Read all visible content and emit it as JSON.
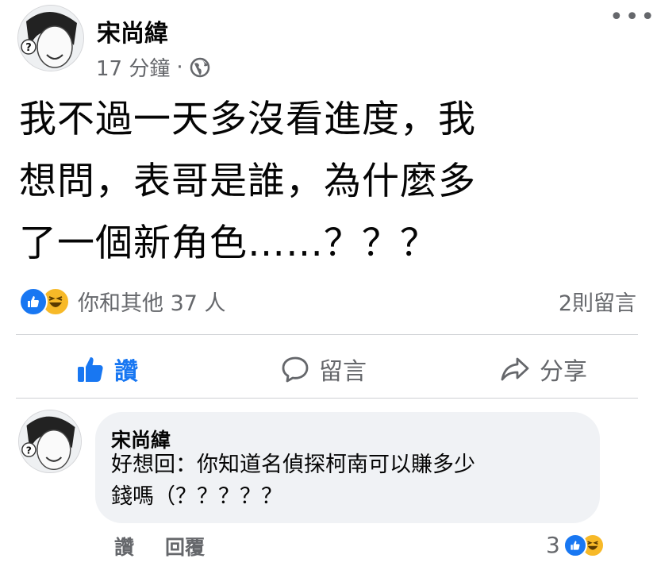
{
  "post": {
    "author": "宋尚緯",
    "time": "17 分鐘",
    "separator": "·",
    "text": "我不過一天多沒看進度，我\n想問，表哥是誰，為什麼多\n了一個新角色……？？？"
  },
  "reactions": {
    "summary": "你和其他 37 人",
    "comments": "2則留言",
    "icons": [
      "like-icon",
      "haha-icon"
    ]
  },
  "actions": {
    "like": "讚",
    "comment": "留言",
    "share": "分享"
  },
  "comment": {
    "author": "宋尚緯",
    "text": "好想回：你知道名偵探柯南可以賺多少\n錢嗎（？？？？？",
    "like": "讚",
    "reply": "回覆",
    "reaction_count": "3"
  },
  "colors": {
    "accent": "#1877f2",
    "secondary_text": "#65676b",
    "bubble": "#f0f2f5",
    "haha": "#f7b928"
  }
}
